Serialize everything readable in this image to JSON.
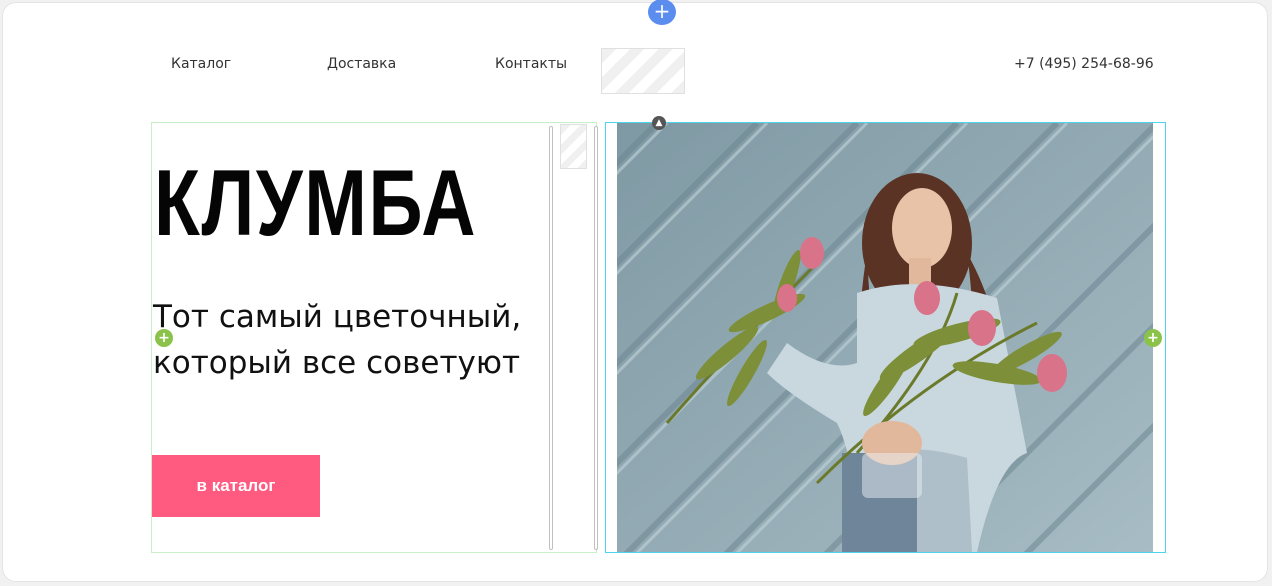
{
  "nav": {
    "items": [
      {
        "label": "Каталог"
      },
      {
        "label": "Доставка"
      },
      {
        "label": "Контакты"
      }
    ],
    "phone": "+7 (495) 254-68-96"
  },
  "hero": {
    "brand": "КЛУМБА",
    "tagline_line1": "Тот самый цветочный,",
    "tagline_line2": "который все советуют",
    "cta_label": "в каталог"
  },
  "editor": {
    "add_icon": "plus-icon",
    "collapse_icon": "chevron-up-icon",
    "accent_add": "#5b8def",
    "accent_handles": "#8bc34a",
    "accent_selected": "#4dd4ef"
  },
  "colors": {
    "cta": "#ff5a80",
    "wall": "#8aa3ad"
  }
}
